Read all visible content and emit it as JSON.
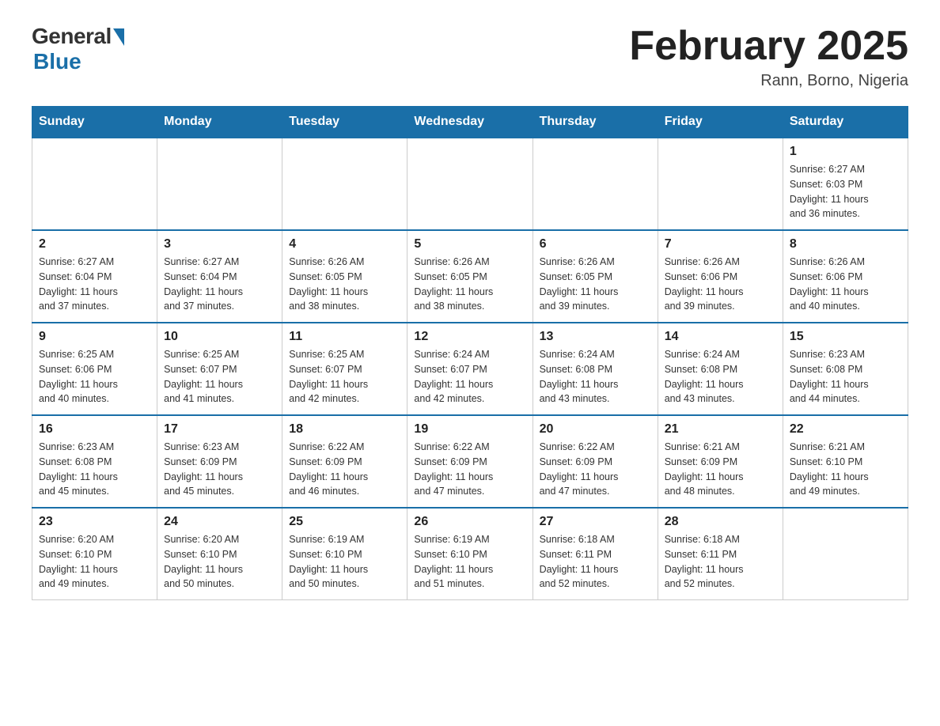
{
  "header": {
    "logo_general": "General",
    "logo_blue": "Blue",
    "month_title": "February 2025",
    "location": "Rann, Borno, Nigeria"
  },
  "days_of_week": [
    "Sunday",
    "Monday",
    "Tuesday",
    "Wednesday",
    "Thursday",
    "Friday",
    "Saturday"
  ],
  "weeks": [
    [
      {
        "day": "",
        "info": ""
      },
      {
        "day": "",
        "info": ""
      },
      {
        "day": "",
        "info": ""
      },
      {
        "day": "",
        "info": ""
      },
      {
        "day": "",
        "info": ""
      },
      {
        "day": "",
        "info": ""
      },
      {
        "day": "1",
        "info": "Sunrise: 6:27 AM\nSunset: 6:03 PM\nDaylight: 11 hours\nand 36 minutes."
      }
    ],
    [
      {
        "day": "2",
        "info": "Sunrise: 6:27 AM\nSunset: 6:04 PM\nDaylight: 11 hours\nand 37 minutes."
      },
      {
        "day": "3",
        "info": "Sunrise: 6:27 AM\nSunset: 6:04 PM\nDaylight: 11 hours\nand 37 minutes."
      },
      {
        "day": "4",
        "info": "Sunrise: 6:26 AM\nSunset: 6:05 PM\nDaylight: 11 hours\nand 38 minutes."
      },
      {
        "day": "5",
        "info": "Sunrise: 6:26 AM\nSunset: 6:05 PM\nDaylight: 11 hours\nand 38 minutes."
      },
      {
        "day": "6",
        "info": "Sunrise: 6:26 AM\nSunset: 6:05 PM\nDaylight: 11 hours\nand 39 minutes."
      },
      {
        "day": "7",
        "info": "Sunrise: 6:26 AM\nSunset: 6:06 PM\nDaylight: 11 hours\nand 39 minutes."
      },
      {
        "day": "8",
        "info": "Sunrise: 6:26 AM\nSunset: 6:06 PM\nDaylight: 11 hours\nand 40 minutes."
      }
    ],
    [
      {
        "day": "9",
        "info": "Sunrise: 6:25 AM\nSunset: 6:06 PM\nDaylight: 11 hours\nand 40 minutes."
      },
      {
        "day": "10",
        "info": "Sunrise: 6:25 AM\nSunset: 6:07 PM\nDaylight: 11 hours\nand 41 minutes."
      },
      {
        "day": "11",
        "info": "Sunrise: 6:25 AM\nSunset: 6:07 PM\nDaylight: 11 hours\nand 42 minutes."
      },
      {
        "day": "12",
        "info": "Sunrise: 6:24 AM\nSunset: 6:07 PM\nDaylight: 11 hours\nand 42 minutes."
      },
      {
        "day": "13",
        "info": "Sunrise: 6:24 AM\nSunset: 6:08 PM\nDaylight: 11 hours\nand 43 minutes."
      },
      {
        "day": "14",
        "info": "Sunrise: 6:24 AM\nSunset: 6:08 PM\nDaylight: 11 hours\nand 43 minutes."
      },
      {
        "day": "15",
        "info": "Sunrise: 6:23 AM\nSunset: 6:08 PM\nDaylight: 11 hours\nand 44 minutes."
      }
    ],
    [
      {
        "day": "16",
        "info": "Sunrise: 6:23 AM\nSunset: 6:08 PM\nDaylight: 11 hours\nand 45 minutes."
      },
      {
        "day": "17",
        "info": "Sunrise: 6:23 AM\nSunset: 6:09 PM\nDaylight: 11 hours\nand 45 minutes."
      },
      {
        "day": "18",
        "info": "Sunrise: 6:22 AM\nSunset: 6:09 PM\nDaylight: 11 hours\nand 46 minutes."
      },
      {
        "day": "19",
        "info": "Sunrise: 6:22 AM\nSunset: 6:09 PM\nDaylight: 11 hours\nand 47 minutes."
      },
      {
        "day": "20",
        "info": "Sunrise: 6:22 AM\nSunset: 6:09 PM\nDaylight: 11 hours\nand 47 minutes."
      },
      {
        "day": "21",
        "info": "Sunrise: 6:21 AM\nSunset: 6:09 PM\nDaylight: 11 hours\nand 48 minutes."
      },
      {
        "day": "22",
        "info": "Sunrise: 6:21 AM\nSunset: 6:10 PM\nDaylight: 11 hours\nand 49 minutes."
      }
    ],
    [
      {
        "day": "23",
        "info": "Sunrise: 6:20 AM\nSunset: 6:10 PM\nDaylight: 11 hours\nand 49 minutes."
      },
      {
        "day": "24",
        "info": "Sunrise: 6:20 AM\nSunset: 6:10 PM\nDaylight: 11 hours\nand 50 minutes."
      },
      {
        "day": "25",
        "info": "Sunrise: 6:19 AM\nSunset: 6:10 PM\nDaylight: 11 hours\nand 50 minutes."
      },
      {
        "day": "26",
        "info": "Sunrise: 6:19 AM\nSunset: 6:10 PM\nDaylight: 11 hours\nand 51 minutes."
      },
      {
        "day": "27",
        "info": "Sunrise: 6:18 AM\nSunset: 6:11 PM\nDaylight: 11 hours\nand 52 minutes."
      },
      {
        "day": "28",
        "info": "Sunrise: 6:18 AM\nSunset: 6:11 PM\nDaylight: 11 hours\nand 52 minutes."
      },
      {
        "day": "",
        "info": ""
      }
    ]
  ]
}
